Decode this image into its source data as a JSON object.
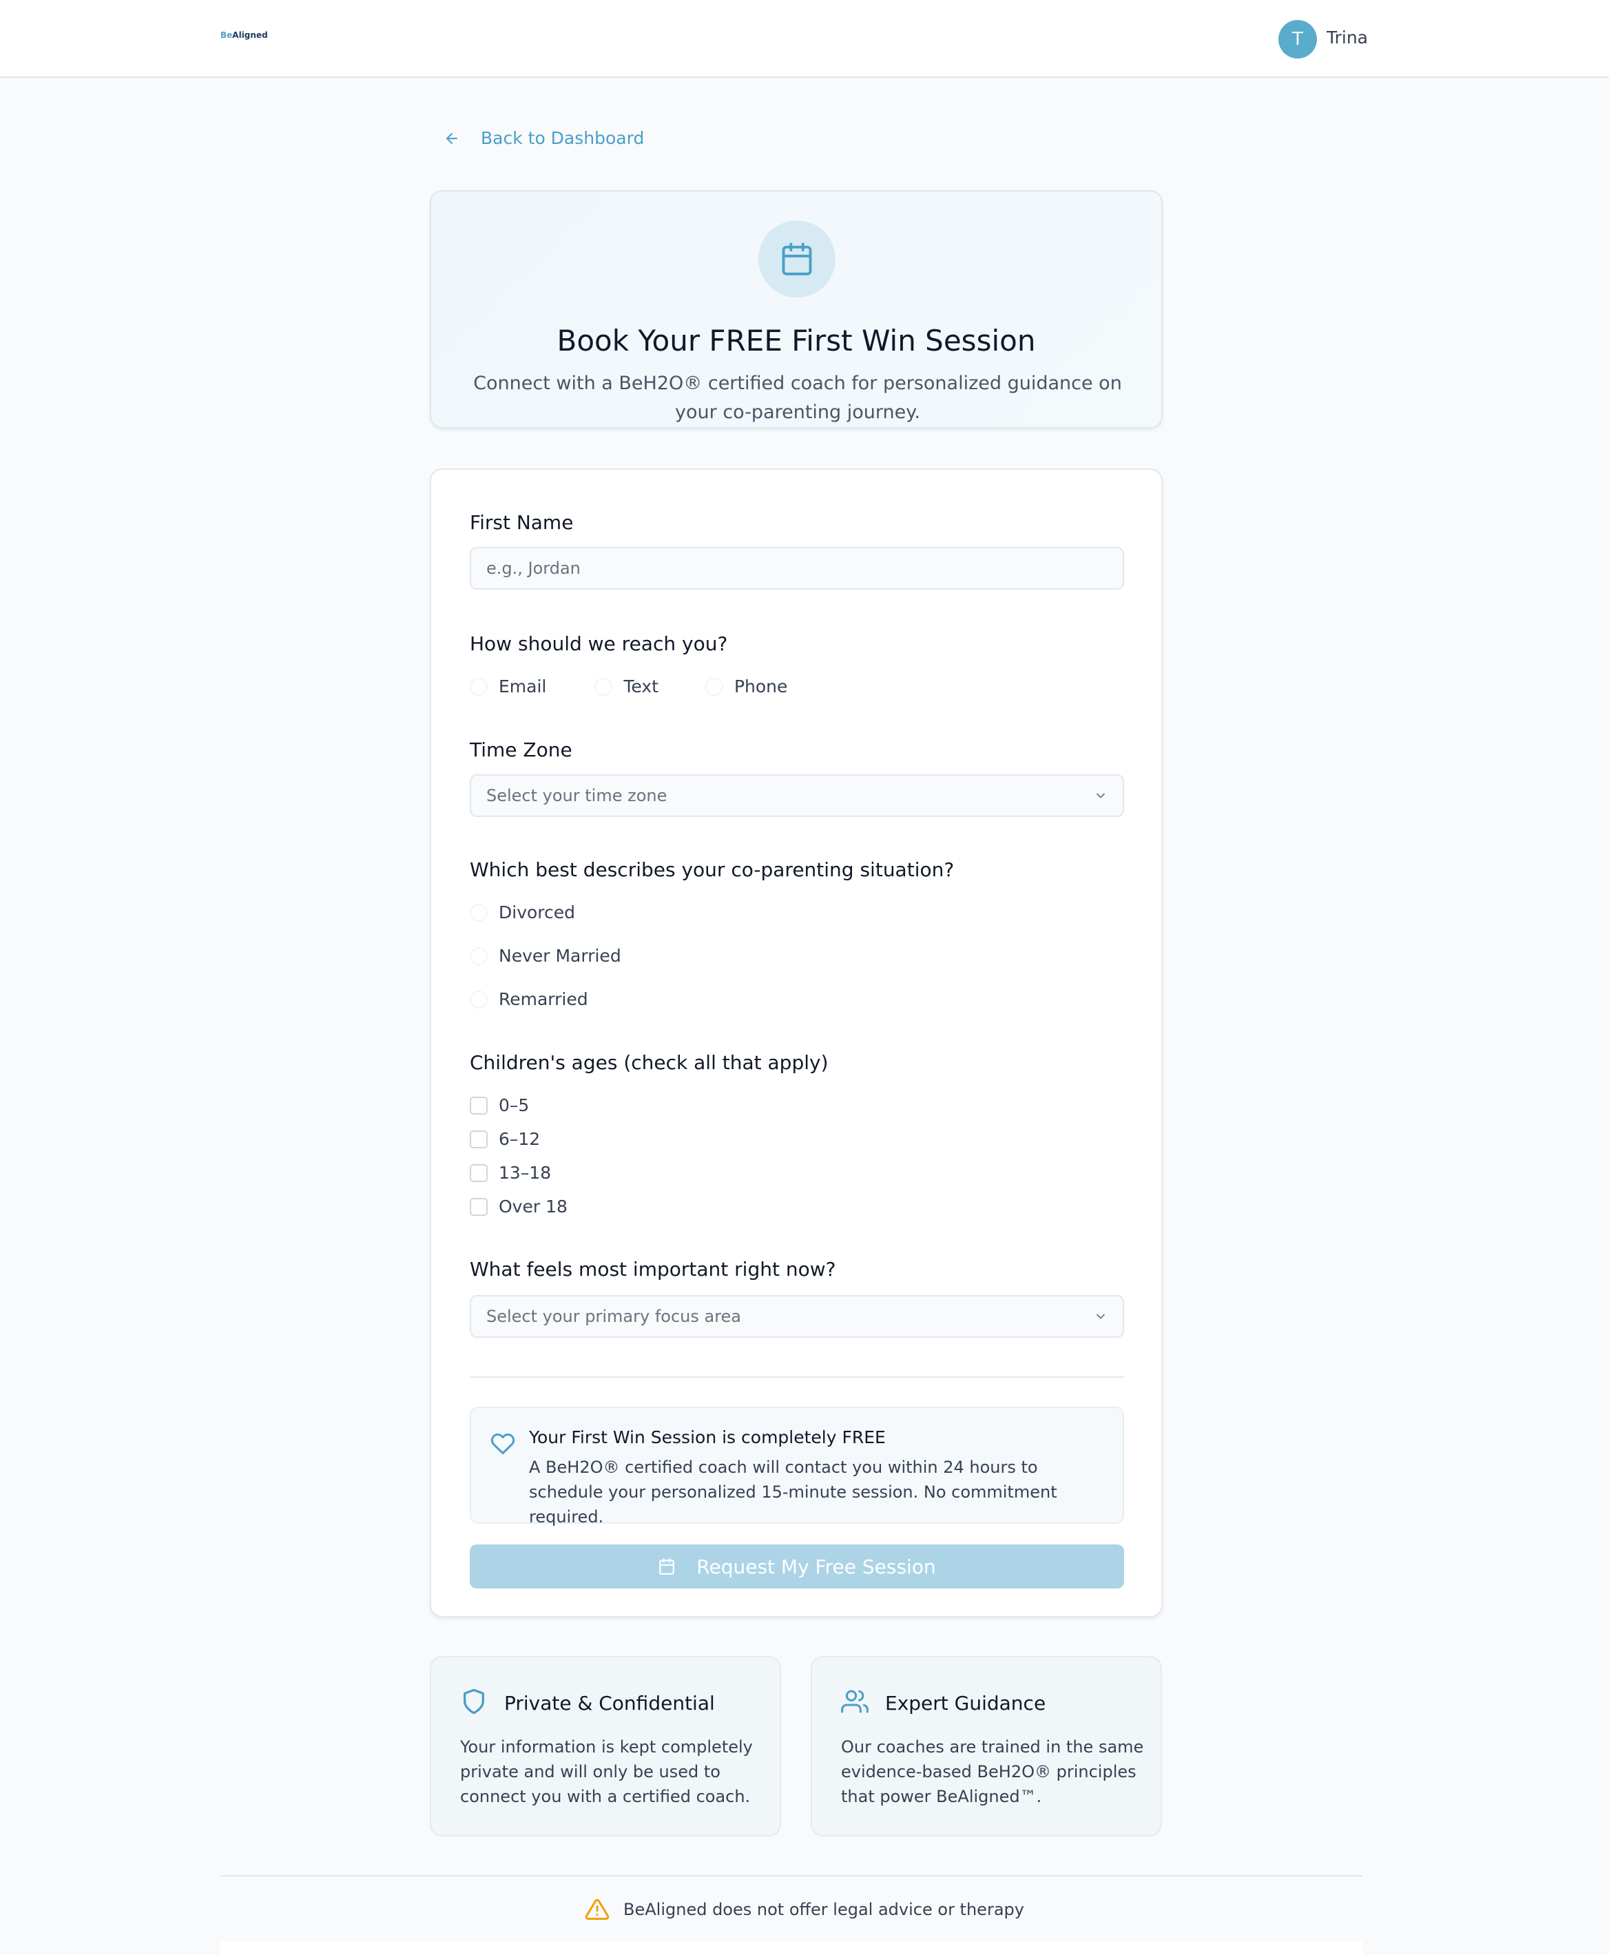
{
  "header": {
    "logo_prefix": "Be",
    "logo_suffix": "Aligned",
    "avatar_initial": "T",
    "username": "Trina"
  },
  "back_link": "Back to Dashboard",
  "hero": {
    "title": "Book Your FREE First Win Session",
    "subtitle": "Connect with a BeH2O® certified coach for personalized guidance on your co-parenting journey."
  },
  "form": {
    "first_name": {
      "label": "First Name",
      "placeholder": "e.g., Jordan",
      "value": ""
    },
    "contact": {
      "label": "How should we reach you?",
      "options": [
        "Email",
        "Text",
        "Phone"
      ]
    },
    "timezone": {
      "label": "Time Zone",
      "placeholder": "Select your time zone"
    },
    "situation": {
      "label": "Which best describes your co-parenting situation?",
      "options": [
        "Divorced",
        "Never Married",
        "Remarried"
      ]
    },
    "ages": {
      "label": "Children's ages (check all that apply)",
      "options": [
        "0–5",
        "6–12",
        "13–18",
        "Over 18"
      ]
    },
    "focus": {
      "label": "What feels most important right now?",
      "placeholder": "Select your primary focus area"
    },
    "info": {
      "title": "Your First Win Session is completely FREE",
      "body": "A BeH2O® certified coach will contact you within 24 hours to schedule your personalized 15-minute session. No commitment required."
    },
    "submit_label": "Request My Free Session"
  },
  "features": [
    {
      "icon": "shield-icon",
      "title": "Private & Confidential",
      "body": "Your information is kept completely private and will only be used to connect you with a certified coach."
    },
    {
      "icon": "users-icon",
      "title": "Expert Guidance",
      "body": "Our coaches are trained in the same evidence-based BeH2O® principles that power BeAligned™."
    }
  ],
  "footer": {
    "disclaimer": "BeAligned does not offer legal advice or therapy"
  },
  "colors": {
    "accent": "#4a9fc7",
    "button_disabled": "#acd4e6",
    "warning": "#f59e0b"
  }
}
